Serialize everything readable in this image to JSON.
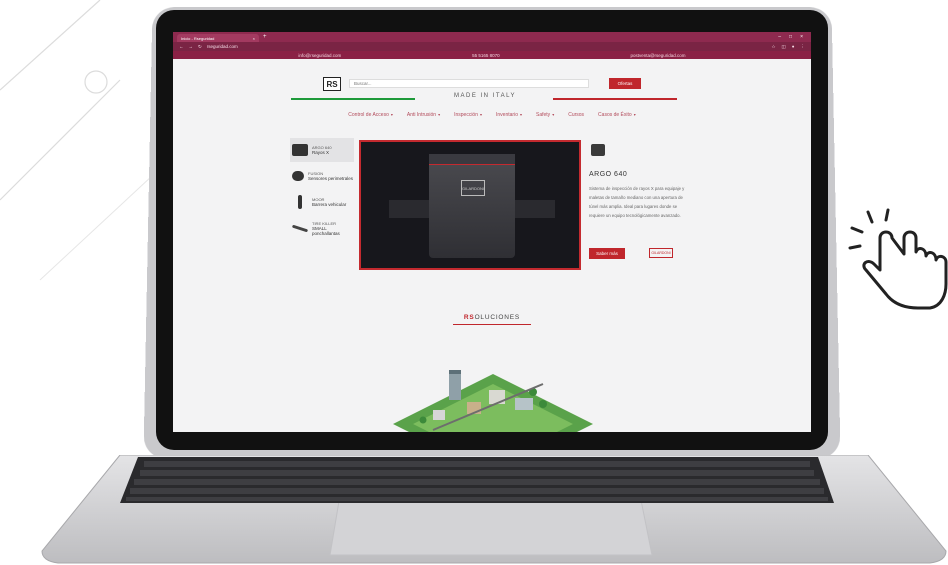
{
  "browser": {
    "tab_title": "Inicio - Rseguridad",
    "tab_close": "×",
    "new_tab": "+",
    "url": "rseguridad.com",
    "window_controls": [
      "–",
      "□",
      "×"
    ]
  },
  "topbar": {
    "email": "info@rseguridad.com",
    "phone": "55 5165 8070",
    "support": "postventa@rseguridad.com"
  },
  "header": {
    "logo": "RS",
    "search_placeholder": "Buscar...",
    "offers_button": "Ofertas",
    "made_in": "MADE IN ITALY"
  },
  "nav": {
    "items": [
      {
        "label": "Control de Acceso",
        "caret": "▾"
      },
      {
        "label": "Anti Intrusión",
        "caret": "▾"
      },
      {
        "label": "Inspección",
        "caret": "▾"
      },
      {
        "label": "Inventario",
        "caret": "▾"
      },
      {
        "label": "Safety",
        "caret": "▾"
      },
      {
        "label": "Cursos",
        "caret": ""
      },
      {
        "label": "Casos de Éxito",
        "caret": "▾"
      }
    ]
  },
  "products": [
    {
      "brand": "ARGO 640",
      "name": "Rayos X"
    },
    {
      "brand": "FUSION",
      "name": "Sensores perimetrales"
    },
    {
      "brand": "MOOR",
      "name": "Barrera vehicular"
    },
    {
      "brand": "TIRE KILLER",
      "name": "SMALL ponchallantas"
    }
  ],
  "featured": {
    "title": "ARGO 640",
    "description": "Sistema de inspección de rayos X para equipaje y maletas de tamaño mediano con una apertura de túnel más amplia. Ideal para lugares donde se requiere un equipo tecnológicamente avanzado.",
    "learn_more": "Saber más",
    "brand_badge": "GILARDONI",
    "hero_brand": "GILARDONI"
  },
  "section": {
    "prefix": "RS",
    "suffix": "OLUCIONES"
  },
  "colors": {
    "brand_red": "#c0262c",
    "browser_chrome": "#8e2a4f",
    "flag_green": "#1e9a3a"
  }
}
